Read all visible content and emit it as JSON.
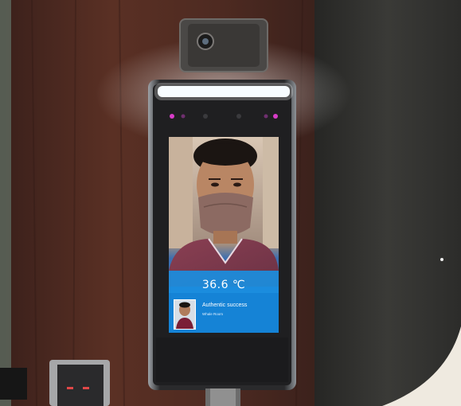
{
  "device": {
    "temperature_reading": "36.6 ℃",
    "result_title": "Authentic success",
    "result_subtitle": "Whale Room"
  },
  "colors": {
    "wall_wood": "#4a2a20",
    "screen_blue": "#1e8fdc",
    "led_bar": "#f4fbff",
    "indicator_pink": "#d83cc8",
    "corner_cream": "#efeae0"
  }
}
